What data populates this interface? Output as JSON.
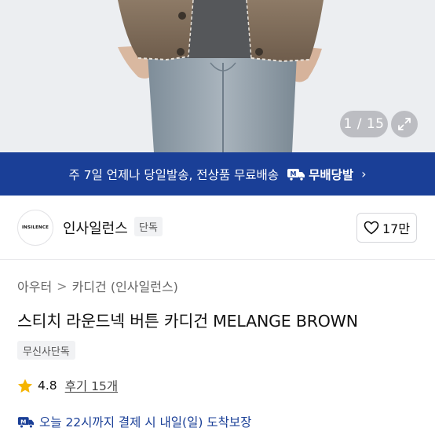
{
  "gallery": {
    "counter": "1 / 15",
    "icons": {
      "expand": "expand-icon"
    }
  },
  "shipping_banner": {
    "text": "주 7일 언제나 당일발송, 전상품 무료배송",
    "badge_label": "무배당발",
    "chevron": "›",
    "accent_color": "#1a3f97"
  },
  "brand": {
    "logo_text": "INSILENCE",
    "name": "인사일런스",
    "tag": "단독",
    "like_count": "17만",
    "icons": {
      "like": "heart-outline-icon"
    }
  },
  "product": {
    "breadcrumb": [
      "아우터",
      "카디건 (인사일런스)"
    ],
    "breadcrumb_separator": ">",
    "title": "스티치 라운드넥 버튼 카디건 MELANGE BROWN",
    "exclusive_tag": "무신사단독",
    "rating": {
      "score": "4.8",
      "reviews_label": "후기 15개",
      "star_color": "#f5b400",
      "icon": "star-icon"
    },
    "delivery_notice": "오늘 22시까지 결제 시 내일(일) 도착보장"
  }
}
